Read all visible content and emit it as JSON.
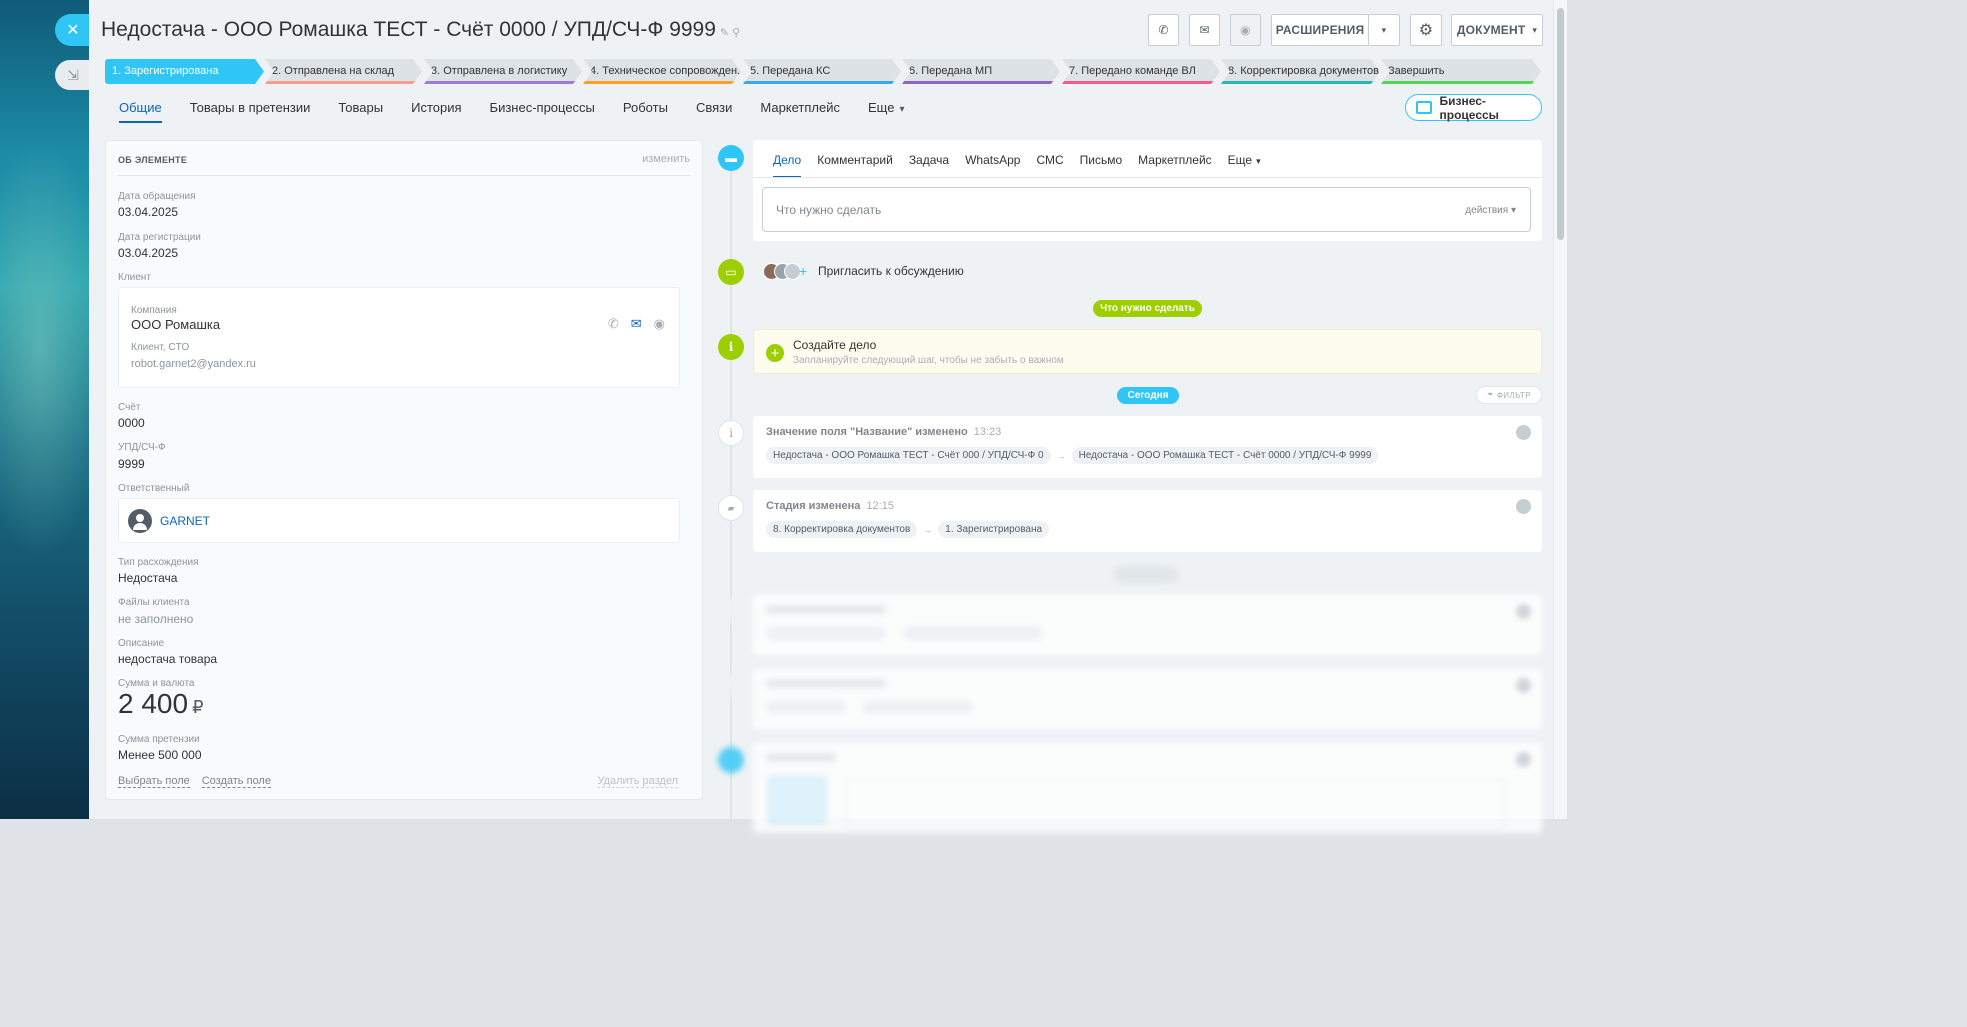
{
  "window": {
    "close_icon": "close-icon",
    "minimize_icon": "collapse-icon"
  },
  "header": {
    "title": "Недостача - ООО Ромашка ТЕСТ - Счёт 0000 / УПД/СЧ-Ф 9999",
    "extensions_label": "РАСШИРЕНИЯ",
    "document_label": "ДОКУМЕНТ"
  },
  "stages": [
    {
      "label": "1. Зарегистрирована",
      "color": "#2fc6f6"
    },
    {
      "label": "2. Отправлена на склад",
      "color": "#ff9a90"
    },
    {
      "label": "3. Отправлена в логистику",
      "color": "#9d7bd8"
    },
    {
      "label": "4. Техническое сопровожден...",
      "color": "#ffa126"
    },
    {
      "label": "5. Передана КС",
      "color": "#39a8ef"
    },
    {
      "label": "6. Передана МП",
      "color": "#8c67c7"
    },
    {
      "label": "7. Передано команде ВЛ",
      "color": "#ef5b8c"
    },
    {
      "label": "8. Корректировка документов",
      "color": "#2ab6b3"
    },
    {
      "label": "Завершить",
      "color": "#55d455"
    }
  ],
  "tabs": [
    {
      "label": "Общие"
    },
    {
      "label": "Товары в претензии"
    },
    {
      "label": "Товары"
    },
    {
      "label": "История"
    },
    {
      "label": "Бизнес-процессы"
    },
    {
      "label": "Роботы"
    },
    {
      "label": "Связи"
    },
    {
      "label": "Маркетплейс"
    },
    {
      "label": "Еще"
    }
  ],
  "bp_button": "Бизнес-процессы",
  "details": {
    "section_title": "ОБ ЭЛЕМЕНТЕ",
    "edit_label": "изменить",
    "request_date_label": "Дата обращения",
    "request_date": "03.04.2025",
    "reg_date_label": "Дата регистрации",
    "reg_date": "03.04.2025",
    "client_label": "Клиент",
    "company_label": "Компания",
    "company": "ООО Ромашка",
    "contact_label": "Клиент, CTO",
    "email": "robot.garnet2@yandex.ru",
    "invoice_label": "Счёт",
    "invoice": "0000",
    "upd_label": "УПД/СЧ-Ф",
    "upd": "9999",
    "responsible_label": "Ответственный",
    "responsible": "GARNET",
    "disc_type_label": "Тип расхождения",
    "disc_type": "Недостача",
    "files_label": "Файлы клиента",
    "files": "не заполнено",
    "desc_label": "Описание",
    "desc": "недостача товара",
    "amount_label": "Сумма и валюта",
    "amount": "2 400",
    "currency": "₽",
    "claim_sum_label": "Сумма претензии",
    "claim_sum": "Менее 500 000",
    "choose_field": "Выбрать поле",
    "create_field": "Создать поле",
    "delete_section": "Удалить раздел"
  },
  "editor": {
    "tabs": [
      "Дело",
      "Комментарий",
      "Задача",
      "WhatsApp",
      "СМС",
      "Письмо",
      "Маркетплейс",
      "Еще"
    ],
    "placeholder": "Что нужно сделать",
    "actions": "действия"
  },
  "timeline": {
    "invite": "Пригласить к обсуждению",
    "todo_pill": "Что нужно сделать",
    "todo_title": "Создайте дело",
    "todo_sub": "Запланируйте следующий шаг, чтобы не забыть о важном",
    "today_pill": "Сегодня",
    "filter": "ФИЛЬТР",
    "events": [
      {
        "title": "Значение поля \"Название\" изменено",
        "time": "13:23",
        "from": "Недостача - ООО Ромашка ТЕСТ - Счёт 000 / УПД/СЧ-Ф 0",
        "to": "Недостача - ООО Ромашка ТЕСТ - Счёт 0000 / УПД/СЧ-Ф 9999"
      },
      {
        "title": "Стадия изменена",
        "time": "12:15",
        "from": "8. Корректировка документов",
        "to": "1. Зарегистрирована"
      }
    ]
  }
}
